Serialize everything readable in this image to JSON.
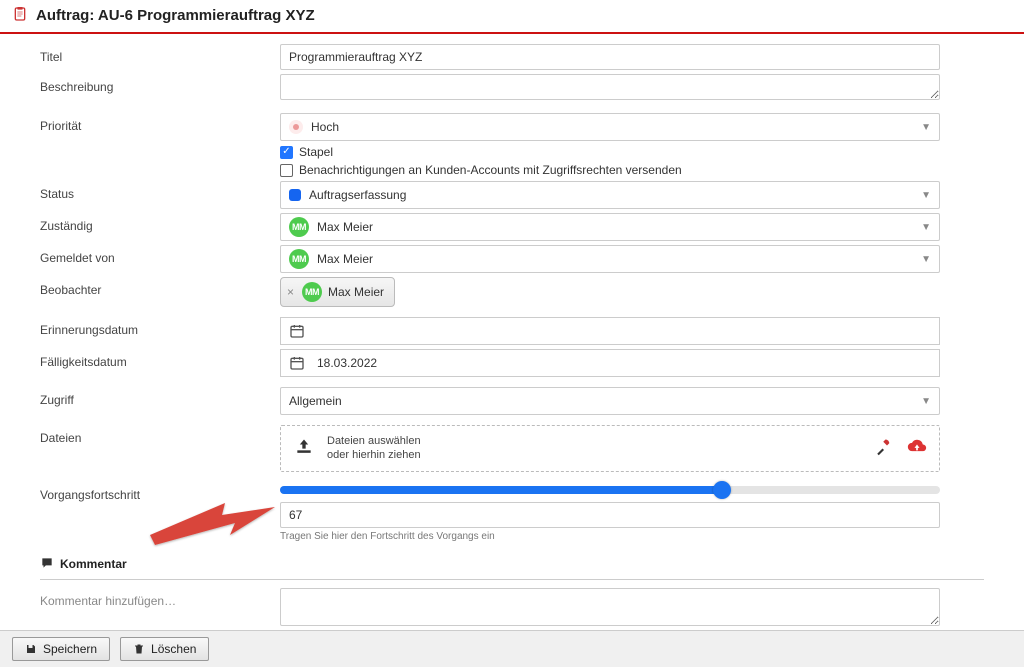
{
  "header": {
    "title": "Auftrag: AU-6 Programmierauftrag XYZ"
  },
  "labels": {
    "titel": "Titel",
    "beschreibung": "Beschreibung",
    "prioritaet": "Priorität",
    "status": "Status",
    "zustaendig": "Zuständig",
    "gemeldet": "Gemeldet von",
    "beobachter": "Beobachter",
    "erinnerung": "Erinnerungsdatum",
    "faelligkeit": "Fälligkeitsdatum",
    "zugriff": "Zugriff",
    "dateien": "Dateien",
    "fortschritt": "Vorgangsfortschritt",
    "kommentar_section": "Kommentar",
    "kommentar_add": "Kommentar hinzufügen…"
  },
  "values": {
    "titel": "Programmierauftrag XYZ",
    "beschreibung": "",
    "prioritaet": "Hoch",
    "stapel_checked": true,
    "stapel_label": "Stapel",
    "benachricht_checked": false,
    "benachricht_label": "Benachrichtigungen an Kunden-Accounts mit Zugriffsrechten versenden",
    "status": "Auftragserfassung",
    "zustaendig": "Max Meier",
    "gemeldet": "Max Meier",
    "beobachter_chip": "Max Meier",
    "avatar_initials": "MM",
    "erinnerung": "",
    "faelligkeit": "18.03.2022",
    "zugriff": "Allgemein",
    "dateien_line1": "Dateien auswählen",
    "dateien_line2": "oder hierhin ziehen",
    "fortschritt_pct": 67,
    "fortschritt_value": "67",
    "fortschritt_helper": "Tragen Sie hier den Fortschritt des Vorgangs ein"
  },
  "buttons": {
    "speichern": "Speichern",
    "loeschen": "Löschen"
  },
  "colors": {
    "accent": "#1a73f2",
    "danger": "#c11",
    "avatar": "#4ecb4e"
  }
}
